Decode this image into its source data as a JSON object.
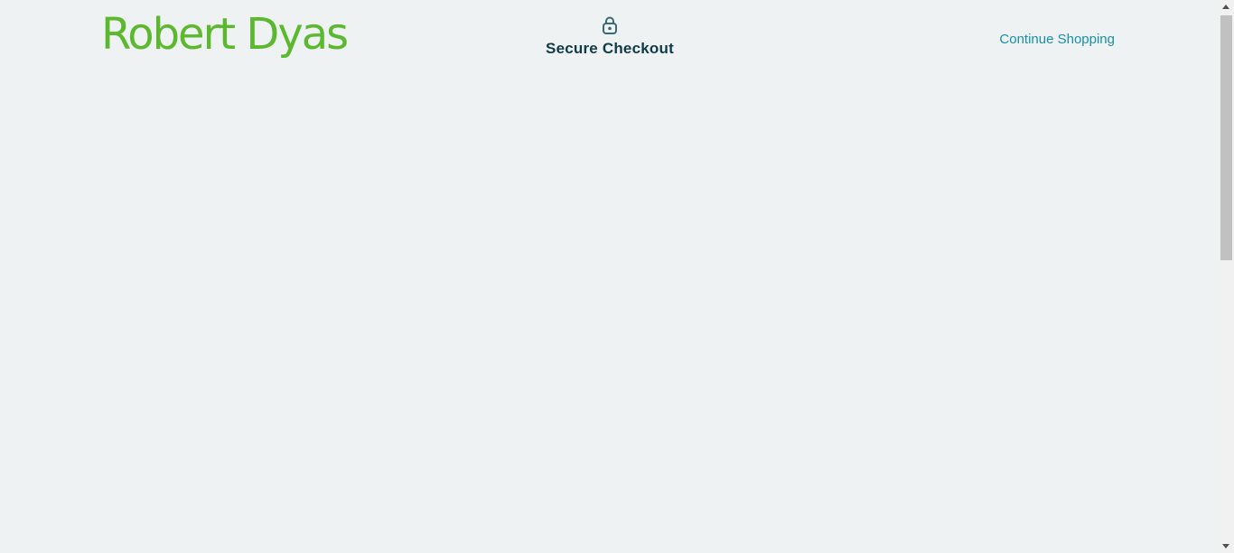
{
  "header": {
    "logo_text": "Robert Dyas",
    "secure_checkout": {
      "icon": "lock-icon",
      "title": "Secure Checkout"
    },
    "continue_link": "Continue Shopping"
  },
  "colors": {
    "brand": "#5cb82f",
    "title": "#0f3b47",
    "link": "#1a8fa6",
    "icon": "#3a6b74",
    "background": "#eef2f2"
  }
}
